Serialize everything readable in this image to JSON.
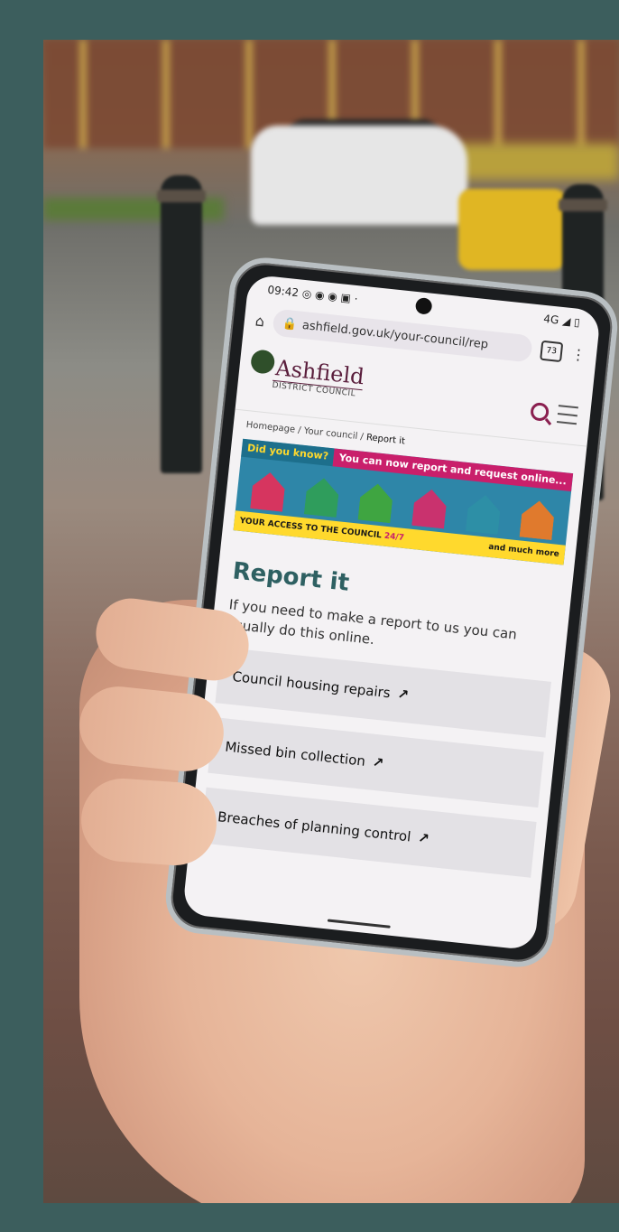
{
  "status_bar": {
    "time": "09:42",
    "network": "4G"
  },
  "browser": {
    "url": "ashfield.gov.uk/your-council/rep",
    "tab_count": "73"
  },
  "site": {
    "logo_name": "Ashfield",
    "logo_sub": "DISTRICT COUNCIL"
  },
  "breadcrumb": {
    "items": [
      "Homepage",
      "Your council",
      "Report it"
    ],
    "separator": "/"
  },
  "banner": {
    "did_you_know": "Did you know?",
    "headline": "You can now report and request online...",
    "footer_left": "YOUR ACCESS TO THE COUNCIL",
    "footer_hours": "24/7",
    "footer_right": "and much more",
    "house_colors": [
      "#d6355f",
      "#2f9d5c",
      "#3fa541",
      "#c9326e",
      "#2d8fa6",
      "#e07a2d"
    ]
  },
  "page": {
    "title": "Report it",
    "intro": "If you need to make a report to us you can usually do this online."
  },
  "links": [
    {
      "label": "Council housing repairs",
      "arrow": "↗"
    },
    {
      "label": "Missed bin collection",
      "arrow": "↗"
    },
    {
      "label": "Breaches of planning control",
      "arrow": "↗"
    }
  ]
}
